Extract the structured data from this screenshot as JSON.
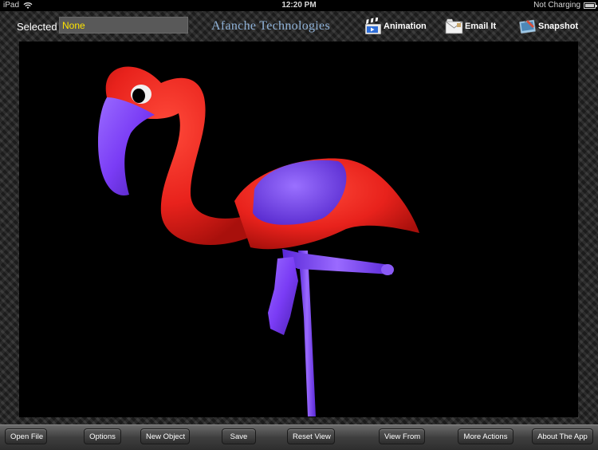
{
  "status_bar": {
    "carrier": "iPad",
    "time": "12:20 PM",
    "charging": "Not Charging"
  },
  "toolbar": {
    "selected_label": "Selected",
    "selected_value": "None",
    "brand": "Afanche Technologies",
    "animation_label": "Animation",
    "email_label": "Email It",
    "snapshot_label": "Snapshot"
  },
  "viewport": {
    "model": "flamingo",
    "body_color": "#e8231f",
    "accent_color": "#7a3cf5",
    "background": "#000000"
  },
  "bottom_bar": {
    "open_file": "Open File",
    "options": "Options",
    "new_object": "New Object",
    "save": "Save",
    "reset_view": "Reset View",
    "view_from": "View From",
    "more_actions": "More Actions",
    "about": "About The App"
  }
}
